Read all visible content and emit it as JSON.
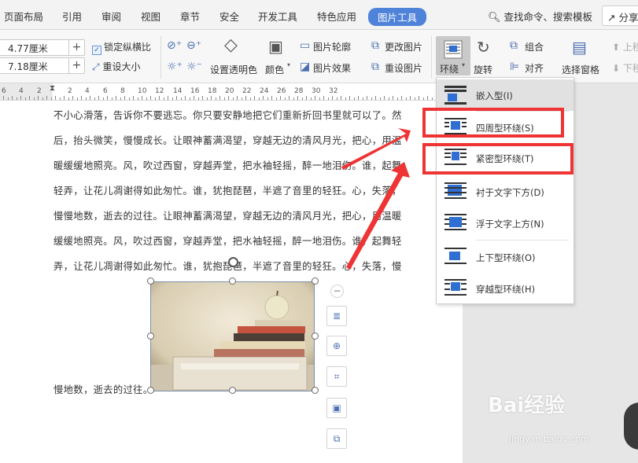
{
  "tabs": [
    "页面布局",
    "引用",
    "审阅",
    "视图",
    "章节",
    "安全",
    "开发工具",
    "特色应用",
    "图片工具"
  ],
  "active_tab": "图片工具",
  "search": {
    "label": "查找命令、搜索模板"
  },
  "share_label": "分享",
  "toolbar": {
    "width_value": "4.77厘米",
    "height_value": "7.18厘米",
    "lock_ratio_label": "锁定纵横比",
    "reset_size_label": "重设大小",
    "transparency_label": "设置透明色",
    "color_label": "颜色",
    "outline_label": "图片轮廓",
    "effect_label": "图片效果",
    "change_pic_label": "更改图片",
    "reset_pic_label": "重设图片",
    "wrap_label": "环绕",
    "rotate_label": "旋转",
    "group_label": "组合",
    "align_label": "对齐",
    "selection_pane_label": "选择窗格",
    "up_label": "上移",
    "down_label": "下移"
  },
  "ruler_numbers": [
    "6",
    "4",
    "2",
    "2",
    "4",
    "6",
    "8",
    "10",
    "12",
    "14",
    "16",
    "18",
    "20",
    "22",
    "24",
    "26",
    "28",
    "30",
    "32"
  ],
  "doc_lines": [
    "不小心滑落，告诉你不要逃忘。你只要安静地把它们重新折回书里就可以了。然",
    "后，抬头微笑，慢慢成长。让眼神蓄满渴望，穿越无边的清风月光，把心，用温",
    "暖缓缓地照亮。风，吹过西窗，穿越弄堂，把水袖轻摇，醉一地泪伤。谁，起舞",
    "轻弄，让花儿凋谢得如此匆忙。谁，犹抱琵琶，半遮了音里的轻狂。心，失落，",
    "慢慢地数，逝去的过往。让眼神蓄满渴望，穿越无边的清风月光，把心，用温暖",
    "缓缓地照亮。风，吹过西窗，穿越弄堂，把水袖轻摇，醉一地泪伤。谁，起舞轻",
    "弄，让花儿凋谢得如此匆忙。谁，犹抱琵琶，半遮了音里的轻狂。心，失落，慢"
  ],
  "doc_last_line": "慢地数，逝去的过往。",
  "wrap_menu": [
    {
      "label": "嵌入型(I)",
      "icon": "inline-wrap-icon"
    },
    {
      "label": "四周型环绕(S)",
      "icon": "square-wrap-icon"
    },
    {
      "label": "紧密型环绕(T)",
      "icon": "tight-wrap-icon"
    },
    {
      "label": "衬于文字下方(D)",
      "icon": "behind-text-icon"
    },
    {
      "label": "浮于文字上方(N)",
      "icon": "in-front-text-icon"
    },
    {
      "label": "上下型环绕(O)",
      "icon": "top-bottom-wrap-icon"
    },
    {
      "label": "穿越型环绕(H)",
      "icon": "through-wrap-icon"
    }
  ],
  "watermark": {
    "brand": "Bai经验",
    "url": "jingyan.baidu.com"
  },
  "colors": {
    "accent": "#4f82d9",
    "highlight": "#ee3434",
    "icon": "#1f5fbf"
  }
}
